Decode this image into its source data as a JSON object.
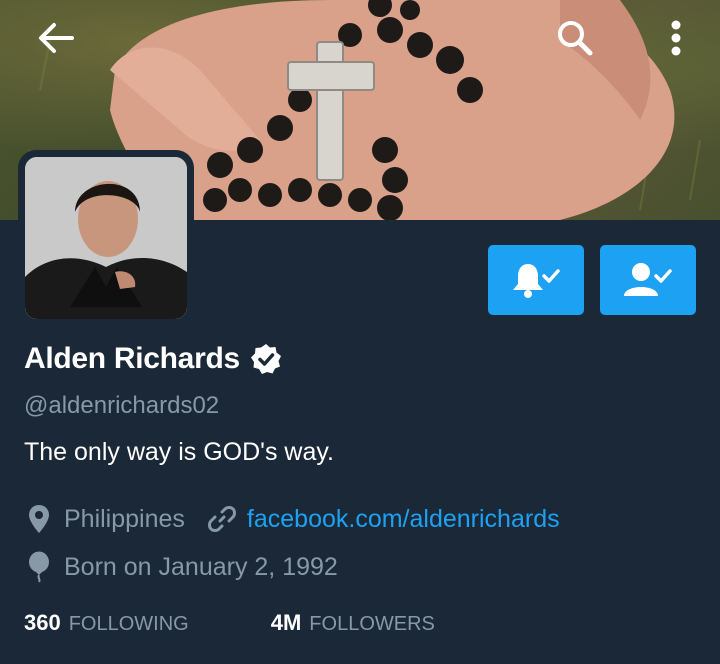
{
  "header": {
    "back_icon": "arrow-left-icon",
    "search_icon": "search-icon",
    "more_icon": "more-vertical-icon"
  },
  "profile": {
    "name": "Alden Richards",
    "verified_icon": "verified-badge-icon",
    "handle": "@aldenrichards02",
    "bio": "The only way is GOD's way.",
    "location": "Philippines",
    "link": "facebook.com/aldenrichards",
    "born": "Born on January 2, 1992"
  },
  "actions": {
    "notify_icon": "bell-check-icon",
    "following_icon": "user-check-icon"
  },
  "stats": {
    "following_count": "360",
    "following_label": "FOLLOWING",
    "followers_count": "4M",
    "followers_label": "FOLLOWERS"
  },
  "colors": {
    "background": "#1b2837",
    "accent": "#1da1f2",
    "secondary_text": "#8899a6"
  }
}
